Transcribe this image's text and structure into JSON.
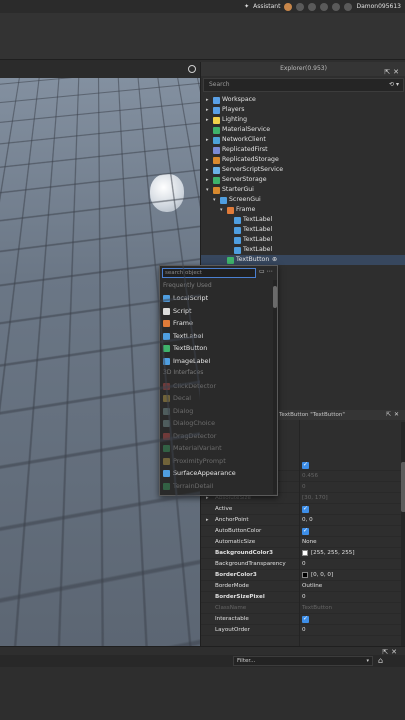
{
  "topbar": {
    "assistant_label": "Assistant",
    "username": "Damon095613"
  },
  "explorer": {
    "title": "Explorer(0.953)",
    "search_placeholder": "Search",
    "items": [
      {
        "label": "Workspace",
        "color": "#5aa0e6"
      },
      {
        "label": "Players",
        "color": "#5aa0e6"
      },
      {
        "label": "Lighting",
        "color": "#f2d24a"
      },
      {
        "label": "MaterialService",
        "color": "#3fb36b"
      },
      {
        "label": "NetworkClient",
        "color": "#4da3d9"
      },
      {
        "label": "ReplicatedFirst",
        "color": "#7b8bd6"
      },
      {
        "label": "ReplicatedStorage",
        "color": "#d98a2e"
      },
      {
        "label": "ServerScriptService",
        "color": "#6bb3e6"
      },
      {
        "label": "ServerStorage",
        "color": "#3fb36b"
      },
      {
        "label": "StarterGui",
        "color": "#d98a2e"
      },
      {
        "label": "ScreenGui",
        "color": "#4f9ee0"
      },
      {
        "label": "Frame",
        "color": "#e07b39"
      },
      {
        "label": "TextLabel",
        "color": "#4f9ee0"
      },
      {
        "label": "TextLabel",
        "color": "#4f9ee0"
      },
      {
        "label": "TextLabel",
        "color": "#4f9ee0"
      },
      {
        "label": "TextLabel",
        "color": "#4f9ee0"
      },
      {
        "label": "TextButton",
        "color": "#3fb36b"
      }
    ]
  },
  "insert_popup": {
    "search_placeholder": "search object",
    "frequently_used_heading": "Frequently Used",
    "frequent": [
      {
        "label": "LocalScript",
        "color": "#4f9ee0"
      },
      {
        "label": "Script",
        "color": "#dcdcdc"
      },
      {
        "label": "Frame",
        "color": "#e07b39"
      },
      {
        "label": "TextLabel",
        "color": "#4f9ee0"
      },
      {
        "label": "TextButton",
        "color": "#3fb36b"
      },
      {
        "label": "ImageLabel",
        "color": "#4f9ee0"
      }
    ],
    "interfaces_heading": "3D Interfaces",
    "interfaces": [
      {
        "label": "ClickDetector",
        "color": "#d9534f"
      },
      {
        "label": "Decal",
        "color": "#d9b84f"
      },
      {
        "label": "Dialog",
        "color": "#8aa"
      },
      {
        "label": "DialogChoice",
        "color": "#8aa"
      },
      {
        "label": "DragDetector",
        "color": "#d9534f"
      },
      {
        "label": "MaterialVariant",
        "color": "#3fb36b"
      },
      {
        "label": "ProximityPrompt",
        "color": "#d9b84f"
      },
      {
        "label": "SurfaceAppearance",
        "color": "#4f9ee0"
      },
      {
        "label": "TerrainDetail",
        "color": "#3fb36b"
      }
    ]
  },
  "properties": {
    "title": "TextButton \"TextButton\"",
    "rows": [
      {
        "name": "",
        "value": "",
        "check": true,
        "dim": false
      },
      {
        "name": "",
        "value": "0.456",
        "dim": true
      },
      {
        "name": "",
        "value": "0",
        "dim": true
      },
      {
        "name": "AbsoluteSize",
        "value": "[30, 170]",
        "dim": true,
        "arrow": true
      },
      {
        "name": "Active",
        "value": "",
        "check": true
      },
      {
        "name": "AnchorPoint",
        "value": "0, 0",
        "arrow": true
      },
      {
        "name": "AutoButtonColor",
        "value": "",
        "check": true
      },
      {
        "name": "AutomaticSize",
        "value": "None"
      },
      {
        "name": "BackgroundColor3",
        "value": "[255, 255, 255]",
        "bold": true,
        "swatch": "#ffffff"
      },
      {
        "name": "BackgroundTransparency",
        "value": "0"
      },
      {
        "name": "BorderColor3",
        "value": "[0, 0, 0]",
        "bold": true,
        "swatch": "#000000"
      },
      {
        "name": "BorderMode",
        "value": "Outline"
      },
      {
        "name": "BorderSizePixel",
        "value": "0",
        "bold": true
      },
      {
        "name": "ClassName",
        "value": "TextButton",
        "dim": true
      },
      {
        "name": "Interactable",
        "value": "",
        "check": true
      },
      {
        "name": "LayoutOrder",
        "value": "0"
      }
    ]
  },
  "bottom": {
    "filter_label": "Filter..."
  }
}
